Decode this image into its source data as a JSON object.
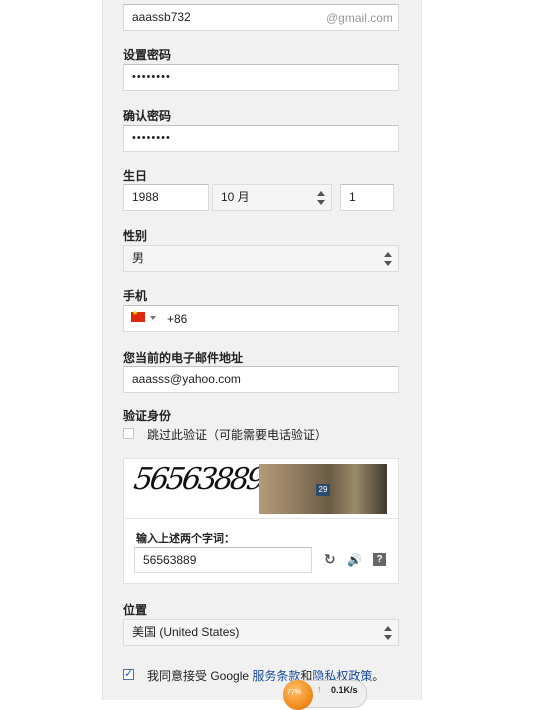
{
  "username": {
    "value": "aaassb732",
    "suffix": "@gmail.com"
  },
  "password": {
    "label": "设置密码",
    "value": "••••••••"
  },
  "confirm_password": {
    "label": "确认密码",
    "value": "••••••••"
  },
  "birthday": {
    "label": "生日",
    "year": "1988",
    "month": "10 月",
    "day": "1"
  },
  "gender": {
    "label": "性别",
    "value": "男"
  },
  "phone": {
    "label": "手机",
    "country_code": "+86",
    "flag": "china-flag-icon"
  },
  "current_email": {
    "label": "您当前的电子邮件地址",
    "value": "aaasss@yahoo.com"
  },
  "verification": {
    "label": "验证身份",
    "skip_text": "跳过此验证（可能需要电话验证）",
    "captcha_text": "56563889",
    "photo_number": "29",
    "prompt": "输入上述两个字词：",
    "input_value": "56563889"
  },
  "location": {
    "label": "位置",
    "value": "美国 (United States)"
  },
  "agreement": {
    "prefix": "我同意接受 Google ",
    "terms": "服务条款",
    "and": "和",
    "privacy": "隐私权政策",
    "suffix": "。"
  },
  "network_widget": {
    "percent": "77%",
    "speed": "0.1K/s"
  }
}
